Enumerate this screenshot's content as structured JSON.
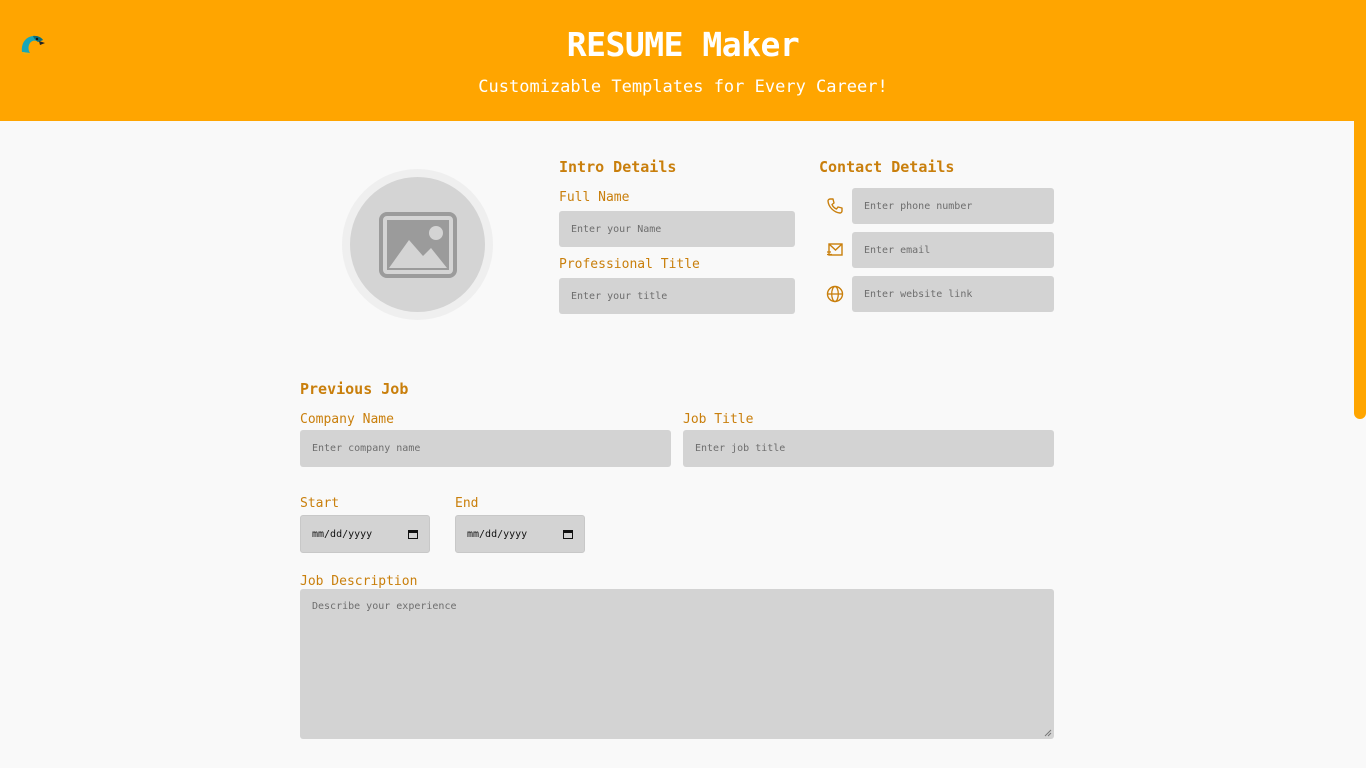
{
  "header": {
    "title": "RESUME Maker",
    "subtitle": "Customizable Templates for Every Career!",
    "logo_icon": "parrot-logo-icon",
    "background_color": "#ffa500"
  },
  "avatar": {
    "icon": "image-placeholder-icon"
  },
  "intro": {
    "title": "Intro Details",
    "full_name_label": "Full Name",
    "full_name_placeholder": "Enter your Name",
    "professional_title_label": "Professional Title",
    "professional_title_placeholder": "Enter your title"
  },
  "contact": {
    "title": "Contact Details",
    "phone_placeholder": "Enter phone number",
    "email_placeholder": "Enter email",
    "website_placeholder": "Enter website link",
    "phone_icon": "phone-icon",
    "email_icon": "email-icon",
    "website_icon": "globe-icon"
  },
  "previous_job": {
    "title": "Previous Job",
    "company_label": "Company Name",
    "company_placeholder": "Enter company name",
    "job_title_label": "Job Title",
    "job_title_placeholder": "Enter job title",
    "start_label": "Start",
    "start_value": "mm/dd/yyyy",
    "end_label": "End",
    "end_value": "mm/dd/yyyy",
    "description_label": "Job Description",
    "description_placeholder": "Describe your experience"
  },
  "colors": {
    "accent": "#ffa500",
    "label": "#c97f0c",
    "input_bg": "#d3d3d3",
    "page_bg": "#f9f9f9"
  }
}
